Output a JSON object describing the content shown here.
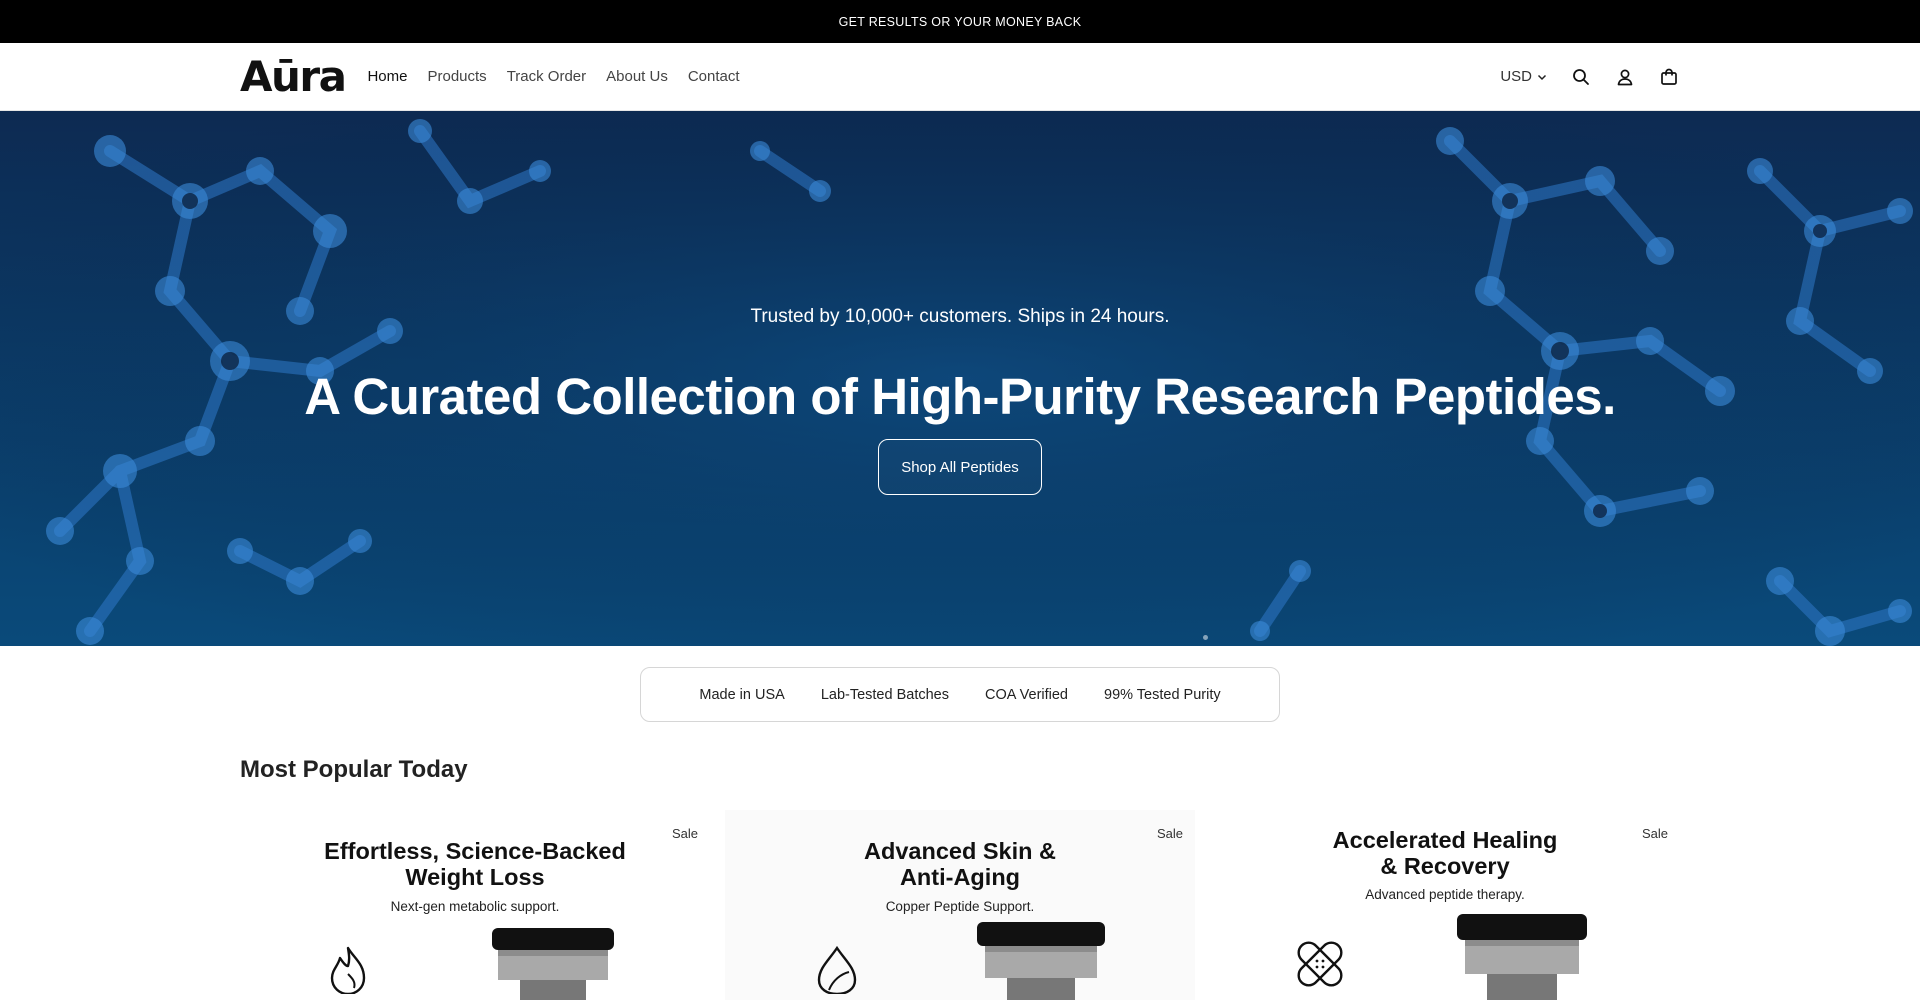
{
  "announcement": "GET RESULTS OR YOUR MONEY BACK",
  "header": {
    "logo": "Aūra",
    "nav": [
      "Home",
      "Products",
      "Track Order",
      "About Us",
      "Contact"
    ],
    "currency": "USD"
  },
  "hero": {
    "tagline": "Trusted by 10,000+ customers. Ships in 24 hours.",
    "title": "A Curated Collection of High-Purity Research Peptides.",
    "cta": "Shop All Peptides"
  },
  "trust_badges": [
    "Made in USA",
    "Lab-Tested Batches",
    "COA Verified",
    "99% Tested Purity"
  ],
  "popular": {
    "title": "Most Popular Today",
    "cards": [
      {
        "title_line1": "Effortless, Science-Backed",
        "title_line2": "Weight Loss",
        "subtitle": "Next-gen metabolic support.",
        "badge": "Sale",
        "icon": "flame-icon"
      },
      {
        "title_line1": "Advanced Skin &",
        "title_line2": "Anti-Aging",
        "subtitle": "Copper Peptide Support.",
        "badge": "Sale",
        "icon": "leaf-drop-icon"
      },
      {
        "title_line1": "Accelerated Healing",
        "title_line2": "& Recovery",
        "subtitle": "Advanced peptide therapy.",
        "badge": "Sale",
        "icon": "bandage-icon"
      }
    ]
  },
  "colors": {
    "announcement_bg": "#000000",
    "hero_bg": "#0b3a66",
    "molecule": "#2f79c9"
  }
}
